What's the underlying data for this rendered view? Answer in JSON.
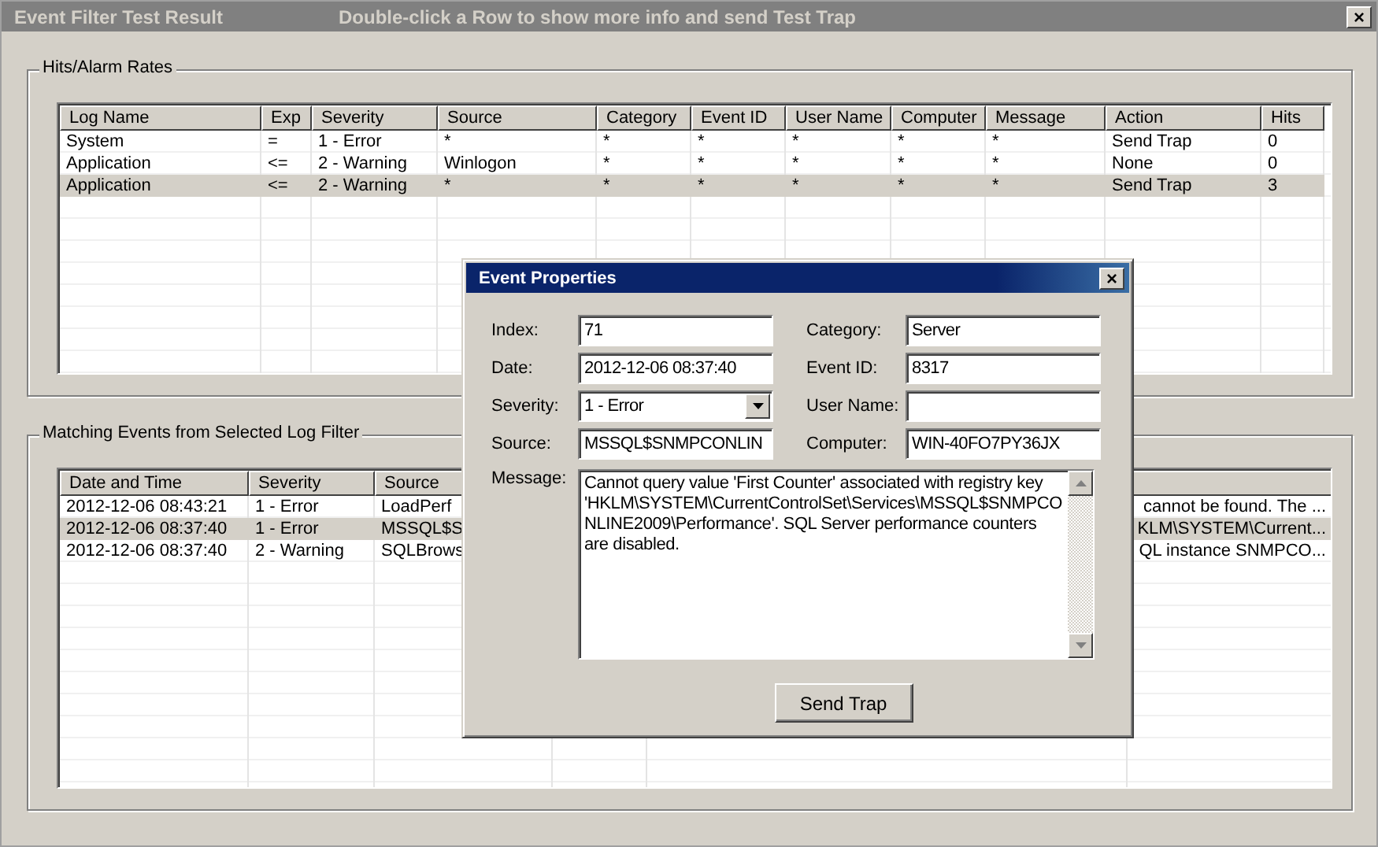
{
  "window": {
    "title": "Event Filter Test Result",
    "hint": "Double-click a Row to show more info and send Test Trap",
    "close": "×"
  },
  "hits_group": {
    "title": "Hits/Alarm Rates",
    "table": {
      "columns": [
        "Log Name",
        "Exp",
        "Severity",
        "Source",
        "Category",
        "Event ID",
        "User Name",
        "Computer",
        "Message",
        "Action",
        "Hits"
      ],
      "rows": [
        {
          "selected": false,
          "cells": [
            "System",
            "=",
            "1 - Error",
            "*",
            "*",
            "*",
            "*",
            "*",
            "*",
            "Send Trap",
            "0"
          ]
        },
        {
          "selected": false,
          "cells": [
            "Application",
            "<=",
            "2 - Warning",
            "Winlogon",
            "*",
            "*",
            "*",
            "*",
            "*",
            "None",
            "0"
          ]
        },
        {
          "selected": true,
          "cells": [
            "Application",
            "<=",
            "2 - Warning",
            "*",
            "*",
            "*",
            "*",
            "*",
            "*",
            "Send Trap",
            "3"
          ]
        }
      ]
    }
  },
  "events_group": {
    "title": "Matching Events from Selected Log Filter",
    "table": {
      "columns": [
        "Date and Time",
        "Severity",
        "Source"
      ],
      "rows": [
        {
          "selected": false,
          "cells": [
            "2012-12-06 08:43:21",
            "1 - Error",
            "LoadPerf",
            "cannot be found.  The ..."
          ]
        },
        {
          "selected": true,
          "cells": [
            "2012-12-06 08:37:40",
            "1 - Error",
            "MSSQL$S",
            "KLM\\SYSTEM\\Current..."
          ]
        },
        {
          "selected": false,
          "cells": [
            "2012-12-06 08:37:40",
            "2 - Warning",
            "SQLBrows",
            "QL instance SNMPCO..."
          ]
        }
      ]
    }
  },
  "dialog": {
    "title": "Event Properties",
    "close": "×",
    "fields": [
      {
        "label": "Index:",
        "value": "71",
        "kind": "text"
      },
      {
        "label": "Category:",
        "value": "Server",
        "kind": "text"
      },
      {
        "label": "Date:",
        "value": "2012-12-06 08:37:40",
        "kind": "text"
      },
      {
        "label": "Event ID:",
        "value": "8317",
        "kind": "text"
      },
      {
        "label": "Severity:",
        "value": "1 - Error",
        "kind": "dropdown"
      },
      {
        "label": "User Name:",
        "kind": "text"
      },
      {
        "label": "Source:",
        "value": "MSSQL$SNMPCONLIN",
        "kind": "text"
      },
      {
        "label": "Computer:",
        "value": "WIN-40FO7PY36JX",
        "kind": "text"
      }
    ],
    "message": {
      "label": "Message:",
      "value": "Cannot query value 'First Counter' associated with registry key 'HKLM\\SYSTEM\\CurrentControlSet\\Services\\MSSQL$SNMPCONLINE2009\\Performance'. SQL Server performance counters are disabled."
    },
    "button": "Send Trap"
  }
}
